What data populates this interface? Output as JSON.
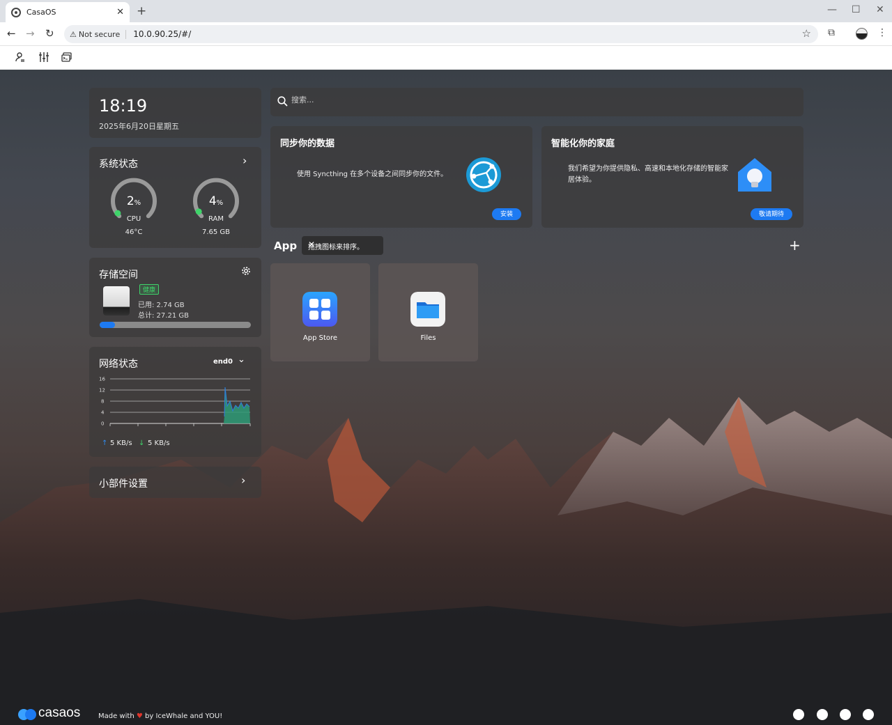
{
  "browser": {
    "tab_title": "CasaOS",
    "tab_close": "✕",
    "new_tab": "+",
    "security_label": "Not secure",
    "url": "10.0.90.25/#/"
  },
  "widgets": {
    "clock": {
      "time": "18:19",
      "date": "2025年6月20日星期五"
    },
    "system": {
      "title": "系统状态",
      "cpu": {
        "percent": 2,
        "value": "2",
        "unit": "%",
        "label": "CPU",
        "sub": "46°C"
      },
      "ram": {
        "percent": 4,
        "value": "4",
        "unit": "%",
        "label": "RAM",
        "sub": "7.65 GB"
      }
    },
    "storage": {
      "title": "存储空间",
      "health": "健康",
      "used": "已用: 2.74 GB",
      "total": "总计: 27.21 GB",
      "used_fraction": 0.1
    },
    "network": {
      "title": "网络状态",
      "interface": "end0",
      "y_ticks": [
        "16",
        "12",
        "8",
        "4",
        "0"
      ],
      "upload": "5 KB/s",
      "download": "5 KB/s"
    },
    "settings": {
      "title": "小部件设置"
    }
  },
  "search": {
    "placeholder": "搜索..."
  },
  "promos": [
    {
      "title": "同步你的数据",
      "text": "使用 Syncthing 在多个设备之间同步你的文件。",
      "button": "安装"
    },
    {
      "title": "智能化你的家庭",
      "text": "我们希望为你提供隐私、高速和本地化存储的智能家居体验。",
      "button": "敬请期待"
    }
  ],
  "apps": {
    "title": "App",
    "tooltip": "拖拽图标来排序。",
    "tooltip_close": "✕",
    "add": "+",
    "items": [
      {
        "name": "App Store"
      },
      {
        "name": "Files"
      }
    ]
  },
  "footer": {
    "made_with": "Made with",
    "by": "by IceWhale and YOU!",
    "logo_text": "casaos"
  },
  "colors": {
    "accent": "#1d7af2",
    "gauge_green": "#3fd46a",
    "health_green": "#3fd46a",
    "heart": "#e0352b"
  }
}
